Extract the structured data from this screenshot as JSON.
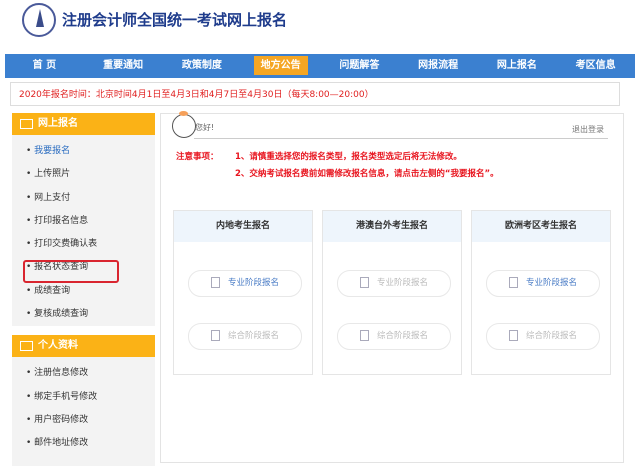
{
  "header": {
    "title": "注册会计师全国统一考试网上报名"
  },
  "nav": [
    "首 页",
    "重要通知",
    "政策制度",
    "地方公告",
    "问题解答",
    "网报流程",
    "网上报名",
    "考区信息"
  ],
  "notice": "2020年报名时间：北京时间4月1日至4月3日和4月7日至4月30日（每天8:00—20:00）",
  "sidebar": {
    "section1": "网上报名",
    "items1": [
      "我要报名",
      "上传照片",
      "网上支付",
      "打印报名信息",
      "打印交费确认表",
      "报名状态查询",
      "成绩查询",
      "复核成绩查询"
    ],
    "section2": "个人资料",
    "items2": [
      "注册信息修改",
      "绑定手机号修改",
      "用户密码修改",
      "邮件地址修改"
    ]
  },
  "main": {
    "greeting": "您好!",
    "logout": "退出登录",
    "notice_label": "注意事项：",
    "notice1": "1、请慎重选择您的报名类型，报名类型选定后将无法修改。",
    "notice2": "2、交纳考试报名费前如需修改报名信息，请点击左侧的“我要报名”。",
    "cards": [
      {
        "title": "内地考生报名",
        "b1": "专业阶段报名",
        "b2": "综合阶段报名"
      },
      {
        "title": "港澳台外考生报名",
        "b1": "专业阶段报名",
        "b2": "综合阶段报名"
      },
      {
        "title": "欧洲考区考生报名",
        "b1": "专业阶段报名",
        "b2": "综合阶段报名"
      }
    ]
  }
}
